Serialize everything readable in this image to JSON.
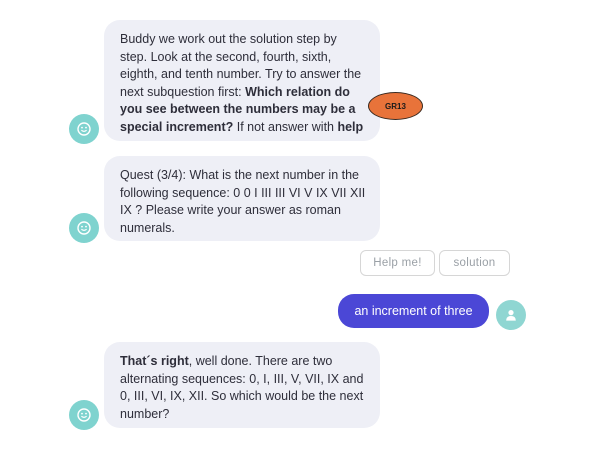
{
  "messages": [
    {
      "parts": [
        {
          "text": "Buddy we work out the solution step by step. Look at the second, fourth, sixth, eighth, and tenth number. Try to answer the next subquestion first: ",
          "bold": false
        },
        {
          "text": "Which relation do you see between the numbers may be a special increment?",
          "bold": true
        },
        {
          "text": " If not answer with ",
          "bold": false
        },
        {
          "text": "help",
          "bold": true
        }
      ]
    },
    {
      "parts": [
        {
          "text": "Quest (3/4): What is the next number in the following sequence: 0 0 I III III VI V IX VII XII IX ? Please write your answer as roman numerals.",
          "bold": false
        }
      ]
    },
    {
      "parts": [
        {
          "text": "That´s right",
          "bold": true
        },
        {
          "text": ", well done. There are two alternating sequences: 0, I, III, V, VII, IX and 0, III, VI, IX, XII. So which would be the next number?",
          "bold": false
        }
      ]
    }
  ],
  "quick_replies": {
    "help_label": "Help me!",
    "solution_label": "solution"
  },
  "user_message": "an increment of three",
  "badge_label": "GR13",
  "icons": {
    "bot_avatar": "smiley-face-icon",
    "user_avatar": "user-person-icon"
  },
  "colors": {
    "bot_bubble": "#eeeff6",
    "user_bubble": "#4b47d6",
    "avatar": "#7fd3cf",
    "badge": "#e8733a"
  }
}
